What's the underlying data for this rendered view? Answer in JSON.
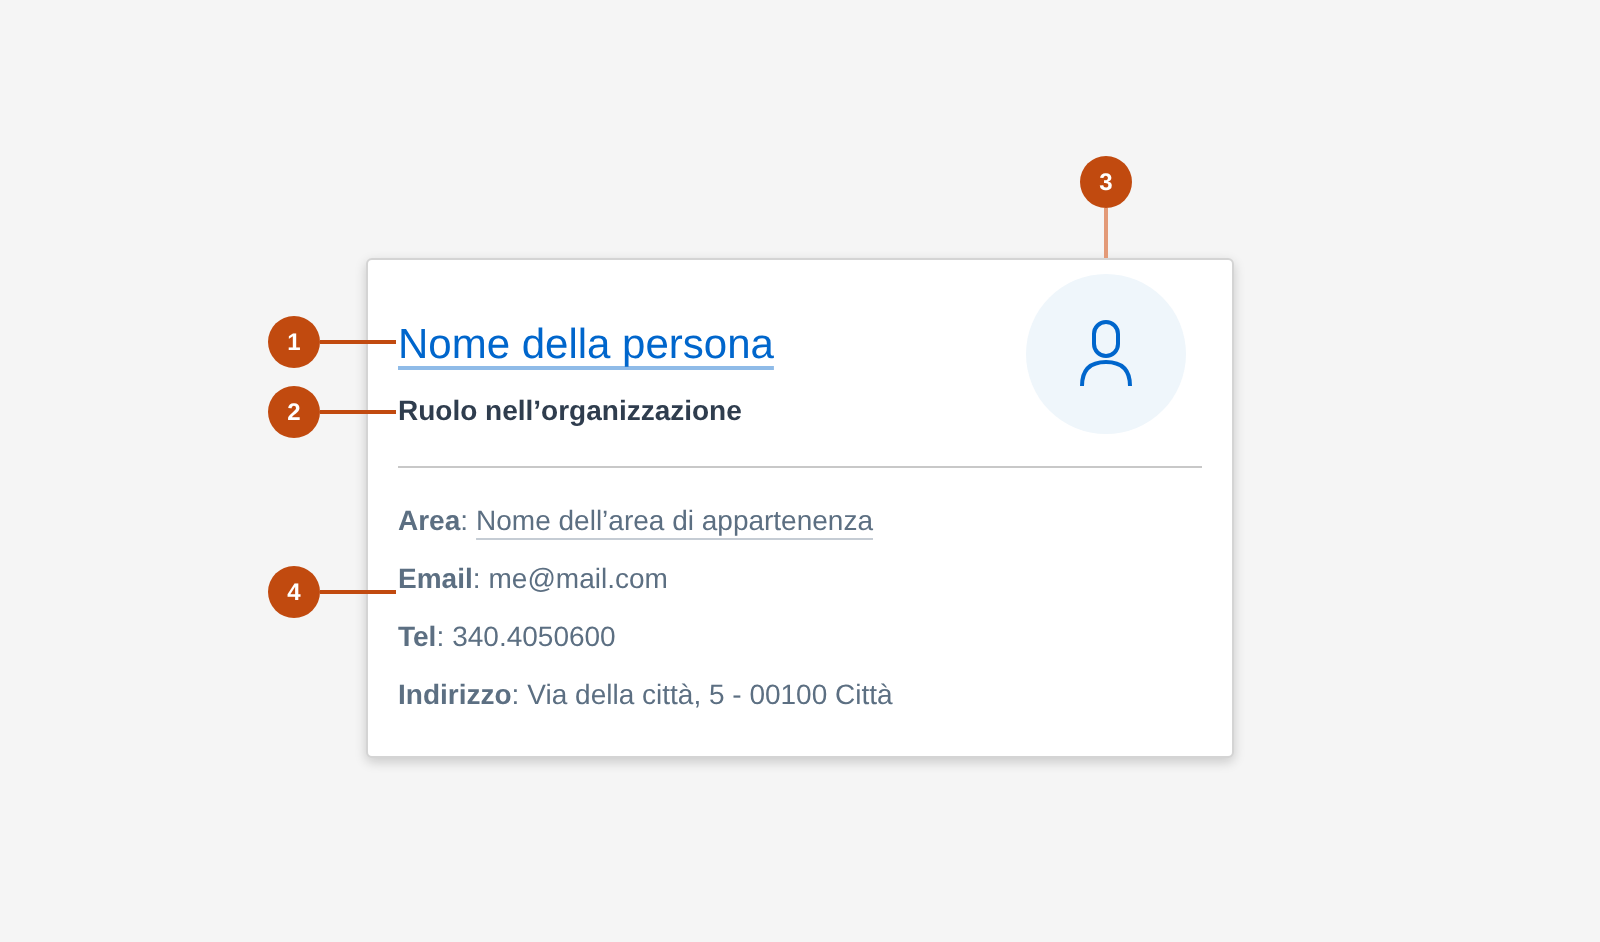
{
  "card": {
    "name": "Nome della persona",
    "role": "Ruolo nell’organizzazione",
    "details": [
      {
        "kind": "link",
        "label": "**Area**:",
        "value": "Nome dell’area di appartenenza"
      },
      {
        "kind": "text",
        "label": "**Email**:",
        "value": "me@mail.com"
      },
      {
        "kind": "text",
        "label": "**Tel**:",
        "value": "340.4050600"
      },
      {
        "kind": "text",
        "label": "**Indirizzo**:",
        "value": "Via della città, 5 - 00100 Città"
      }
    ]
  },
  "annotations": [
    {
      "number": "1"
    },
    {
      "number": "2"
    },
    {
      "number": "3"
    },
    {
      "number": "4"
    }
  ]
}
